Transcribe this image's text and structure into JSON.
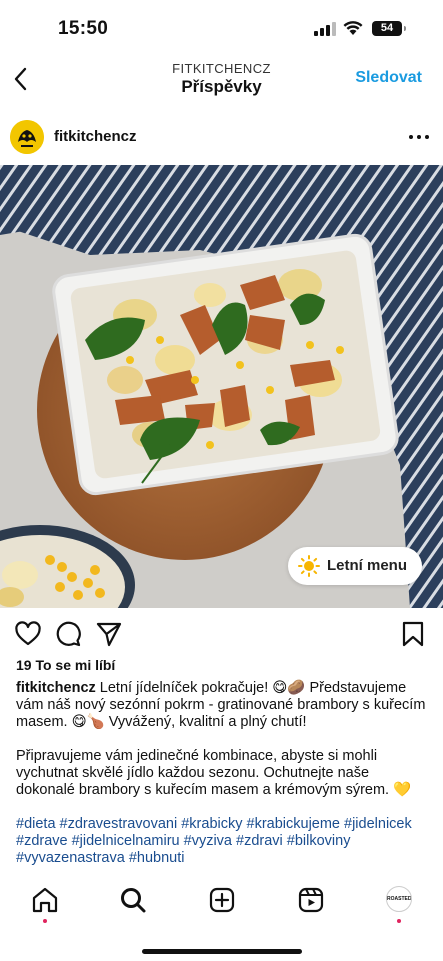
{
  "status_bar": {
    "time": "15:50",
    "battery": "54"
  },
  "header": {
    "account_caps": "FITKITCHENCZ",
    "title": "Příspěvky",
    "follow_label": "Sledovat"
  },
  "post": {
    "author": "fitkitchencz",
    "badge_label": "Letní menu",
    "likes": "19 To se mi líbí",
    "caption_username": "fitkitchencz",
    "caption_p1": " Letní jídelníček pokračuje! 😋🥔 Představujeme vám náš nový sezónní  pokrm - gratinované brambory s kuřecím masem. 😋🍗 Vyvážený, kvalitní a plný chutí!",
    "caption_p2": "Připravujeme vám jedinečné kombinace, abyste si mohli vychutnat skvělé jídlo každou sezonu. Ochutnejte naše dokonalé brambory s kuřecím masem a krémovým sýrem. 💛",
    "hashtags": "#dieta #zdravestravovani #krabicky #krabickujeme #jidelnicek #zdrave #jidelnicelnamiru #vyziva #zdravi #bilkoviny #vyvazenastrava #hubnuti"
  },
  "bottom_nav": {
    "profile_label": "ROASTED"
  },
  "icons": [
    "back-icon",
    "more-icon",
    "heart-icon",
    "comment-icon",
    "share-icon",
    "bookmark-icon",
    "home-icon",
    "search-icon",
    "create-icon",
    "reels-icon",
    "sun-icon"
  ]
}
